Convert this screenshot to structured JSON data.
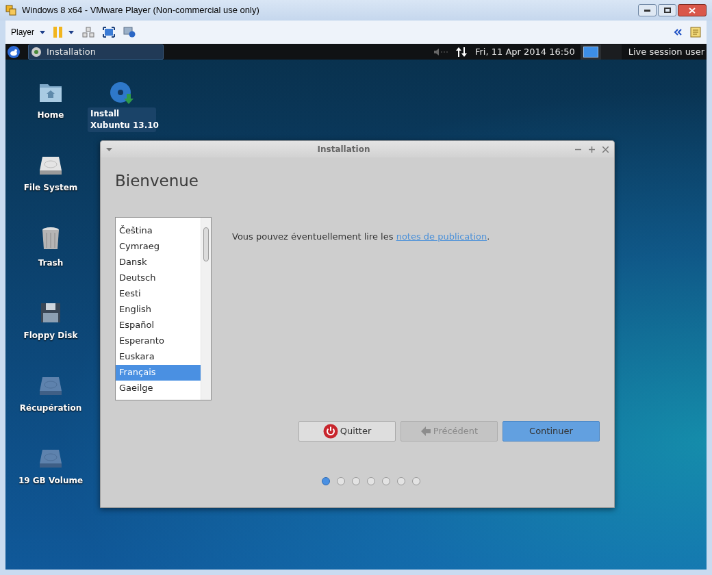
{
  "host_window": {
    "title": "Windows 8 x64 - VMware Player (Non-commercial use only)",
    "player_menu": "Player"
  },
  "guest_panel": {
    "task": "Installation",
    "clock": "Fri, 11 Apr 2014 16:50",
    "user": "Live session user"
  },
  "desktop_icons": [
    {
      "label": "Home",
      "kind": "home",
      "selected": false
    },
    {
      "label": "File System",
      "kind": "drive",
      "selected": false
    },
    {
      "label": "Trash",
      "kind": "trash",
      "selected": false
    },
    {
      "label": "Floppy Disk",
      "kind": "floppy",
      "selected": false
    },
    {
      "label": "Récupération",
      "kind": "volume",
      "selected": false
    },
    {
      "label": "19 GB Volume",
      "kind": "volume",
      "selected": false
    }
  ],
  "install_icon": {
    "label_lines": [
      "Install",
      "Xubuntu 13.10"
    ],
    "selected": true
  },
  "dialog": {
    "title": "Installation",
    "heading": "Bienvenue",
    "languages": [
      {
        "label": "Čeština",
        "selected": false
      },
      {
        "label": "Cymraeg",
        "selected": false
      },
      {
        "label": "Dansk",
        "selected": false
      },
      {
        "label": "Deutsch",
        "selected": false
      },
      {
        "label": "Eesti",
        "selected": false
      },
      {
        "label": "English",
        "selected": false
      },
      {
        "label": "Español",
        "selected": false
      },
      {
        "label": "Esperanto",
        "selected": false
      },
      {
        "label": "Euskara",
        "selected": false
      },
      {
        "label": "Français",
        "selected": true
      },
      {
        "label": "Gaeilge",
        "selected": false
      }
    ],
    "message": {
      "text": "Vous pouvez éventuellement lire les",
      "link": "notes de publication",
      "end": "."
    },
    "buttons": [
      {
        "label": "Quitter",
        "kind": "quit",
        "disabled": false
      },
      {
        "label": "Précédent",
        "kind": "back",
        "disabled": true
      },
      {
        "label": "Continuer",
        "kind": "primary",
        "disabled": false
      }
    ],
    "steps": [
      {
        "selected": true
      },
      {
        "selected": false
      },
      {
        "selected": false
      },
      {
        "selected": false
      },
      {
        "selected": false
      },
      {
        "selected": false
      },
      {
        "selected": false
      }
    ]
  }
}
